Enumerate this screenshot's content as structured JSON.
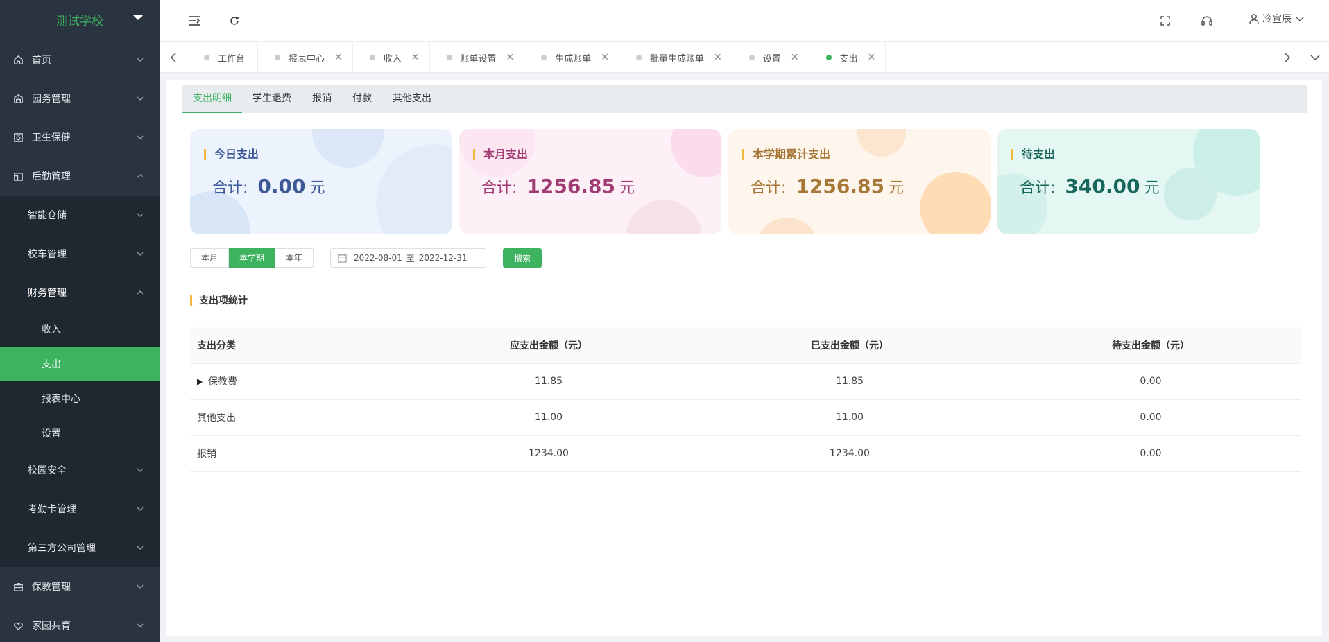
{
  "school": "测试学校",
  "sidebar": {
    "items": [
      {
        "label": "首页"
      },
      {
        "label": "园务管理"
      },
      {
        "label": "卫生保健"
      },
      {
        "label": "后勤管理"
      },
      {
        "label": "智能仓储"
      },
      {
        "label": "校车管理"
      },
      {
        "label": "财务管理"
      },
      {
        "label": "收入"
      },
      {
        "label": "支出"
      },
      {
        "label": "报表中心"
      },
      {
        "label": "设置"
      },
      {
        "label": "校园安全"
      },
      {
        "label": "考勤卡管理"
      },
      {
        "label": "第三方公司管理"
      },
      {
        "label": "保教管理"
      },
      {
        "label": "家园共育"
      }
    ]
  },
  "user": {
    "name": "冷宣辰"
  },
  "tabs": [
    {
      "label": "工作台"
    },
    {
      "label": "报表中心"
    },
    {
      "label": "收入"
    },
    {
      "label": "账单设置"
    },
    {
      "label": "生成账单"
    },
    {
      "label": "批量生成账单"
    },
    {
      "label": "设置"
    },
    {
      "label": "支出"
    }
  ],
  "subtabs": [
    {
      "label": "支出明细"
    },
    {
      "label": "学生退费"
    },
    {
      "label": "报销"
    },
    {
      "label": "付款"
    },
    {
      "label": "其他支出"
    }
  ],
  "cards": [
    {
      "title": "今日支出",
      "prefix": "合计:",
      "value": "0.00",
      "unit": "元"
    },
    {
      "title": "本月支出",
      "prefix": "合计:",
      "value": "1256.85",
      "unit": "元"
    },
    {
      "title": "本学期累计支出",
      "prefix": "合计:",
      "value": "1256.85",
      "unit": "元"
    },
    {
      "title": "待支出",
      "prefix": "合计:",
      "value": "340.00",
      "unit": "元"
    }
  ],
  "filters": {
    "ranges": [
      {
        "label": "本月"
      },
      {
        "label": "本学期"
      },
      {
        "label": "本年"
      }
    ],
    "start_date": "2022-08-01",
    "separator": "至",
    "end_date": "2022-12-31",
    "search_label": "搜索"
  },
  "section_title": "支出项统计",
  "table": {
    "headers": [
      "支出分类",
      "应支出金额（元）",
      "已支出金额（元）",
      "待支出金额（元）"
    ],
    "rows": [
      {
        "category": "保教费",
        "due": "11.85",
        "paid": "11.85",
        "pending": "0.00"
      },
      {
        "category": "其他支出",
        "due": "11.00",
        "paid": "11.00",
        "pending": "0.00"
      },
      {
        "category": "报销",
        "due": "1234.00",
        "paid": "1234.00",
        "pending": "0.00"
      }
    ]
  },
  "colors": {
    "brand": "#3db25f",
    "sidebar_bg": "#2a3440",
    "accent_bar": "#f0b93c"
  }
}
